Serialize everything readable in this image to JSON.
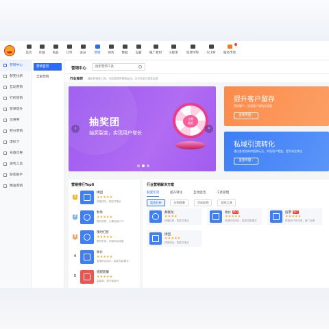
{
  "colors": {
    "primary": "#2c6cf6",
    "orange": "#fb8a4a",
    "purple": "#9b59f0",
    "star": "#f5a623"
  },
  "topnav": {
    "items": [
      {
        "label": "首页",
        "icon": "home-icon"
      },
      {
        "label": "店铺",
        "icon": "store-icon"
      },
      {
        "label": "商品",
        "icon": "goods-icon"
      },
      {
        "label": "订单",
        "icon": "order-icon"
      },
      {
        "label": "会员",
        "icon": "member-icon"
      },
      {
        "label": "营销",
        "icon": "marketing-icon"
      },
      {
        "label": "财务",
        "icon": "finance-icon"
      },
      {
        "label": "数据",
        "icon": "data-icon"
      },
      {
        "label": "设置",
        "icon": "settings-icon"
      },
      {
        "label": "推广素材",
        "icon": "share-icon"
      },
      {
        "label": "小程序",
        "icon": "miniapp-icon"
      },
      {
        "label": "旺博学院",
        "icon": "academy-icon"
      },
      {
        "label": "SCRM",
        "icon": "scrm-icon"
      },
      {
        "label": "服务市场",
        "icon": "market-icon"
      }
    ]
  },
  "sidebar": {
    "items": [
      {
        "label": "营销中心"
      },
      {
        "label": "裂变拉新"
      },
      {
        "label": "互动营销"
      },
      {
        "label": "打折促销"
      },
      {
        "label": "客单提升"
      },
      {
        "label": "优惠券"
      },
      {
        "label": "积分营销"
      },
      {
        "label": "虚拟卡"
      },
      {
        "label": "充值优惠"
      },
      {
        "label": "游戏工具"
      },
      {
        "label": "获客助手"
      },
      {
        "label": "精准营销"
      }
    ]
  },
  "subnav": {
    "items": [
      {
        "label": "营销首页"
      },
      {
        "label": "全部营销"
      }
    ]
  },
  "header": {
    "title": "营销中心",
    "search_placeholder": "搜索营销工具"
  },
  "recommend": {
    "label": "行业推荐",
    "desc": "精彩营销新工具，为商家提供营销玩法，全方位助力商家运营"
  },
  "banner": {
    "title": "抽奖团",
    "subtitle": "抽奖裂变，实现用户增长",
    "wheel_text_1": "立即",
    "wheel_text_2": "抽奖",
    "prev": "‹",
    "next": "›"
  },
  "promos": [
    {
      "title": "提升客户留存",
      "desc": "营销客户，提高客户复购业绩量",
      "button": "查看专题 ›"
    },
    {
      "title": "私域引流转化",
      "desc": "通过各类创新的营销玩法，实现用户裂变，提升成交转化",
      "button": "查看专题 ›"
    }
  ],
  "ranking": {
    "title": "营销排行Top8",
    "items": [
      {
        "rank": "1",
        "name": "拼团",
        "stars": "★★★★★",
        "desc": "拼团成功，裂变式增长"
      },
      {
        "rank": "2",
        "name": "秒杀",
        "stars": "★★★★★",
        "desc": "限时抢购，引爆店铺人气"
      },
      {
        "rank": "3",
        "name": "限时打折",
        "stars": "★★★★★",
        "desc": "限时折扣，刺激购买欲望"
      },
      {
        "rank": "4",
        "name": "砍价",
        "stars": "★★★★★",
        "desc": "邀请好友砍价，裂变拉新模式"
      },
      {
        "rank": "5",
        "name": "搭配套餐",
        "stars": "★★★★★",
        "desc": "高客单，提升客单价"
      }
    ]
  },
  "solution": {
    "title": "行业营销解决方案",
    "tabs": [
      "裂变引流",
      "提升转化",
      "互动促活",
      "工具管理"
    ],
    "tags": [
      "裂变拉新",
      "分销获客",
      "活动促销",
      "游戏工具"
    ],
    "cards": [
      {
        "name": "群接龙",
        "badge": "",
        "stars": "★★★★",
        "desc": "快速拉新，裂变式增长"
      },
      {
        "name": "砍价",
        "badge": "热门",
        "stars": "★★★★★",
        "desc": "邀请好友砍价，裂变拉新模式"
      },
      {
        "name": "投票",
        "badge": "热门",
        "stars": "★★★★★",
        "desc": "提高用户参与度，增广品牌"
      },
      {
        "name": "拼团",
        "badge": "",
        "stars": "★★★★★",
        "desc": "拼团成功，裂变式增长"
      }
    ]
  }
}
